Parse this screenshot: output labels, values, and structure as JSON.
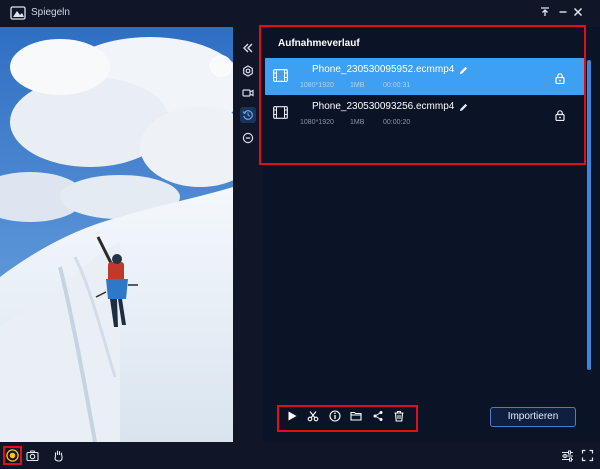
{
  "window": {
    "title": "Spiegeln",
    "icons": {
      "logo": "mirror-app-logo",
      "pin": "pin-icon",
      "minimize": "minimize-icon",
      "close": "close-icon"
    }
  },
  "toolbar": {
    "items": [
      {
        "name": "collapse",
        "icon": "double-chevron-left-icon"
      },
      {
        "name": "settings",
        "icon": "gear-icon"
      },
      {
        "name": "record-video",
        "icon": "video-camera-icon"
      },
      {
        "name": "history",
        "icon": "history-icon",
        "active": true
      },
      {
        "name": "stop",
        "icon": "minus-circle-icon"
      }
    ]
  },
  "history": {
    "title": "Aufnahmeverlauf",
    "records": [
      {
        "name": "Phone_230530095952.ecmmp4",
        "resolution": "1080*1920",
        "size": "1MB",
        "duration": "00:00:31",
        "selected": true
      },
      {
        "name": "Phone_230530093256.ecmmp4",
        "resolution": "1080*1920",
        "size": "1MB",
        "duration": "00:00:20",
        "selected": false
      }
    ]
  },
  "actions": {
    "tools": [
      "play-icon",
      "scissors-icon",
      "info-icon",
      "folder-icon",
      "share-icon",
      "trash-icon"
    ],
    "import_label": "Importieren"
  },
  "bottom": {
    "left": [
      "record-toggle-icon",
      "camera-icon",
      "hand-icon"
    ],
    "right": [
      "settings-sliders-icon",
      "fullscreen-icon"
    ]
  },
  "colors": {
    "background": "#0b1326",
    "selected_row": "#3ea0f2",
    "highlight": "#e0101a",
    "accent": "#3e86db"
  }
}
